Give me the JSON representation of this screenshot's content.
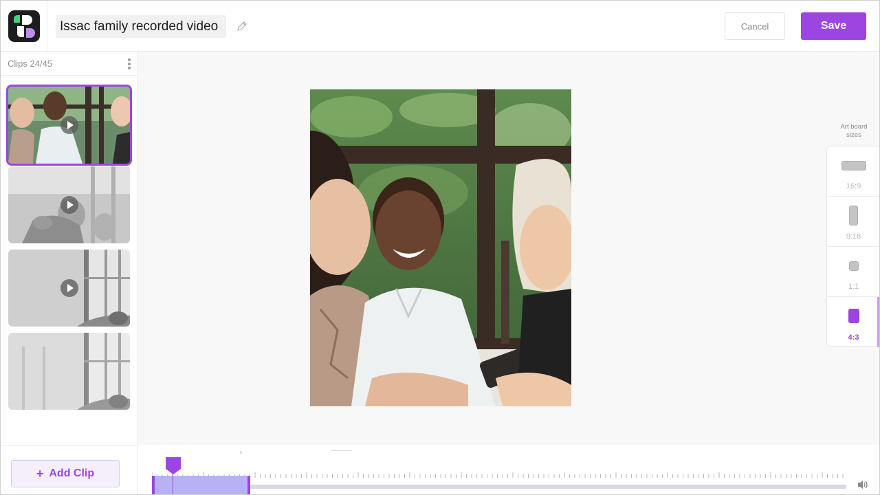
{
  "header": {
    "title": "Issac family recorded video",
    "cancel_label": "Cancel",
    "save_label": "Save"
  },
  "sidebar": {
    "clips_count": "Clips 24/45",
    "add_clip_label": "Add Clip",
    "clips": [
      {
        "selected": true,
        "has_play": true
      },
      {
        "selected": false,
        "has_play": true
      },
      {
        "selected": false,
        "has_play": true
      },
      {
        "selected": false,
        "has_play": false
      }
    ]
  },
  "artboard_sizes": {
    "title": "Art board sizes",
    "options": [
      {
        "label": "16:9",
        "active": false
      },
      {
        "label": "9:16",
        "active": false
      },
      {
        "label": "1:1",
        "active": false
      },
      {
        "label": "4:3",
        "active": true
      }
    ]
  },
  "icons": {
    "logo": "app-logo",
    "edit": "pencil-icon",
    "menu": "kebab-menu-icon",
    "play": "play-icon",
    "volume": "volume-icon"
  },
  "colors": {
    "accent": "#9c45e0",
    "selection": "#b7b2f5",
    "canvas_bg": "#f8f8f8"
  }
}
